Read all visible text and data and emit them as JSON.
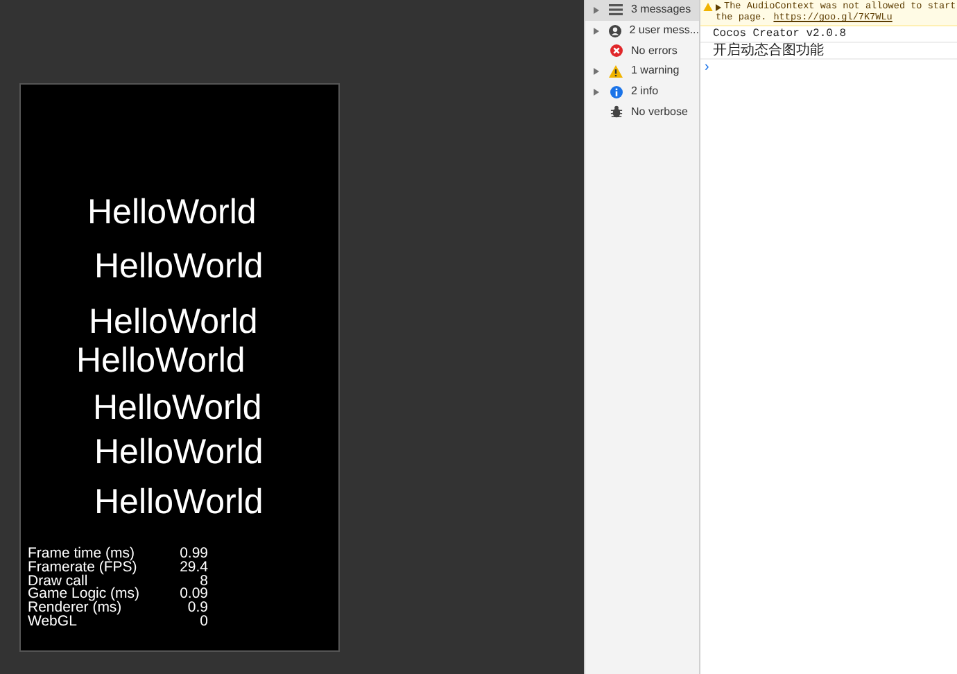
{
  "game": {
    "labels": [
      "HelloWorld",
      "HelloWorld",
      "HelloWorld",
      "HelloWorld",
      "HelloWorld",
      "HelloWorld",
      "HelloWorld"
    ],
    "stats": [
      {
        "label": "Frame time (ms)",
        "value": "0.99"
      },
      {
        "label": "Framerate (FPS)",
        "value": "29.4"
      },
      {
        "label": "Draw call",
        "value": "8"
      },
      {
        "label": "Game Logic (ms)",
        "value": "0.09"
      },
      {
        "label": "Renderer (ms)",
        "value": "0.9"
      },
      {
        "label": "WebGL",
        "value": "0"
      }
    ]
  },
  "sidebar": {
    "items": [
      {
        "kind": "messages",
        "label": "3 messages",
        "selected": true,
        "expanded": false
      },
      {
        "kind": "user",
        "label": "2 user mess...",
        "selected": false,
        "expanded": false
      },
      {
        "kind": "errors",
        "label": "No errors",
        "selected": false
      },
      {
        "kind": "warnings",
        "label": "1 warning",
        "selected": false,
        "expanded": false
      },
      {
        "kind": "info",
        "label": "2 info",
        "selected": false,
        "expanded": false
      },
      {
        "kind": "verbose",
        "label": "No verbose",
        "selected": false
      }
    ]
  },
  "console": {
    "messages": [
      {
        "kind": "warning",
        "text": "The AudioContext was not allowed to start",
        "text_2": "the page.",
        "link": "https://goo.gl/7K7WLu"
      },
      {
        "kind": "log",
        "text": "Cocos Creator v2.0.8"
      },
      {
        "kind": "log",
        "text": "开启动态合图功能"
      }
    ],
    "prompt": "›"
  }
}
